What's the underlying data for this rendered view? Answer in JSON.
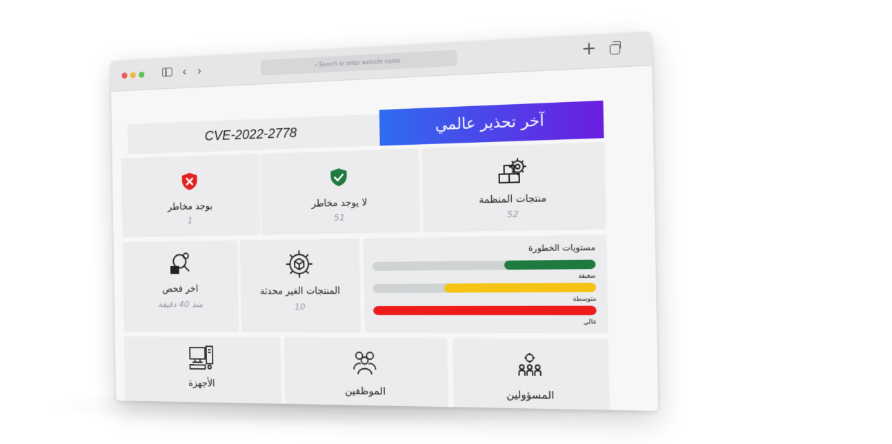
{
  "browser": {
    "address_placeholder": "Search or enter website name",
    "traffic_light_colors": [
      "#ee5a52",
      "#f4b73b",
      "#5bc34a"
    ]
  },
  "alert": {
    "title": "آخر تحذير عالمي",
    "cve": "CVE-2022-2778",
    "gradient": [
      "#2e6cf0",
      "#6a1ee0"
    ]
  },
  "stats": [
    {
      "label": "منتجات المنظمة",
      "value": "52",
      "icon": "product-settings-icon"
    },
    {
      "label": "لا يوجد مخاطر",
      "value": "51",
      "icon": "green-shield-check-icon",
      "color": "#1e7a3f"
    },
    {
      "label": "يوجد مخاطر",
      "value": "1",
      "icon": "red-shield-x-icon",
      "color": "#e12121"
    }
  ],
  "severity": {
    "title": "مستويات الخطورة",
    "levels": [
      {
        "label": "ضعيفة",
        "fraction": 0.4,
        "color": "#1e7a3f"
      },
      {
        "label": "متوسطة",
        "fraction": 0.67,
        "color": "#f5c313"
      },
      {
        "label": "عالي",
        "fraction": 1.0,
        "color": "#ee1b1b"
      }
    ]
  },
  "outdated": {
    "label": "المنتجات الغير محدثة",
    "value": "10",
    "icon": "gear-box-icon"
  },
  "last_scan": {
    "label": "اخر فحص",
    "value": "منذ 40 دقيقة",
    "icon": "scan-search-icon"
  },
  "nav": {
    "admins": {
      "label": "المسؤولين",
      "icon": "admins-group-icon"
    },
    "employees": {
      "label": "الموظفين",
      "icon": "employees-group-icon"
    },
    "devices": {
      "label": "الأجهزة",
      "icon": "devices-icon"
    }
  }
}
